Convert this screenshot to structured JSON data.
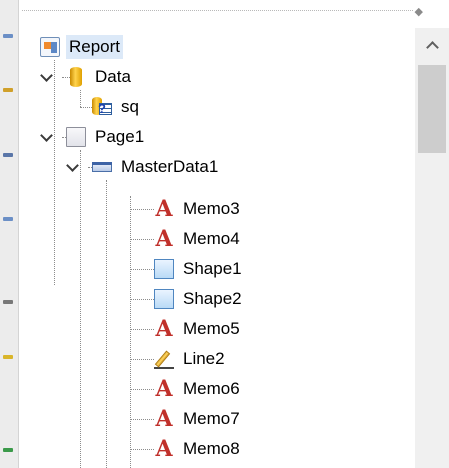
{
  "tree": {
    "nodes": [
      {
        "label": "Report",
        "icon": "report-icon"
      },
      {
        "label": "Data",
        "icon": "database-icon"
      },
      {
        "label": "sq",
        "icon": "query-table-icon"
      },
      {
        "label": "Page1",
        "icon": "page-icon"
      },
      {
        "label": "MasterData1",
        "icon": "data-band-icon"
      },
      {
        "label": "Memo3",
        "icon": "text-memo-icon"
      },
      {
        "label": "Memo4",
        "icon": "text-memo-icon"
      },
      {
        "label": "Shape1",
        "icon": "shape-icon"
      },
      {
        "label": "Shape2",
        "icon": "shape-icon"
      },
      {
        "label": "Memo5",
        "icon": "text-memo-icon"
      },
      {
        "label": "Line2",
        "icon": "line-pencil-icon"
      },
      {
        "label": "Memo6",
        "icon": "text-memo-icon"
      },
      {
        "label": "Memo7",
        "icon": "text-memo-icon"
      },
      {
        "label": "Memo8",
        "icon": "text-memo-icon"
      }
    ],
    "memo_glyph": "A",
    "query_glyph": "?",
    "selected_bg": "#dce9f8",
    "memo_color": "#c0302b"
  }
}
